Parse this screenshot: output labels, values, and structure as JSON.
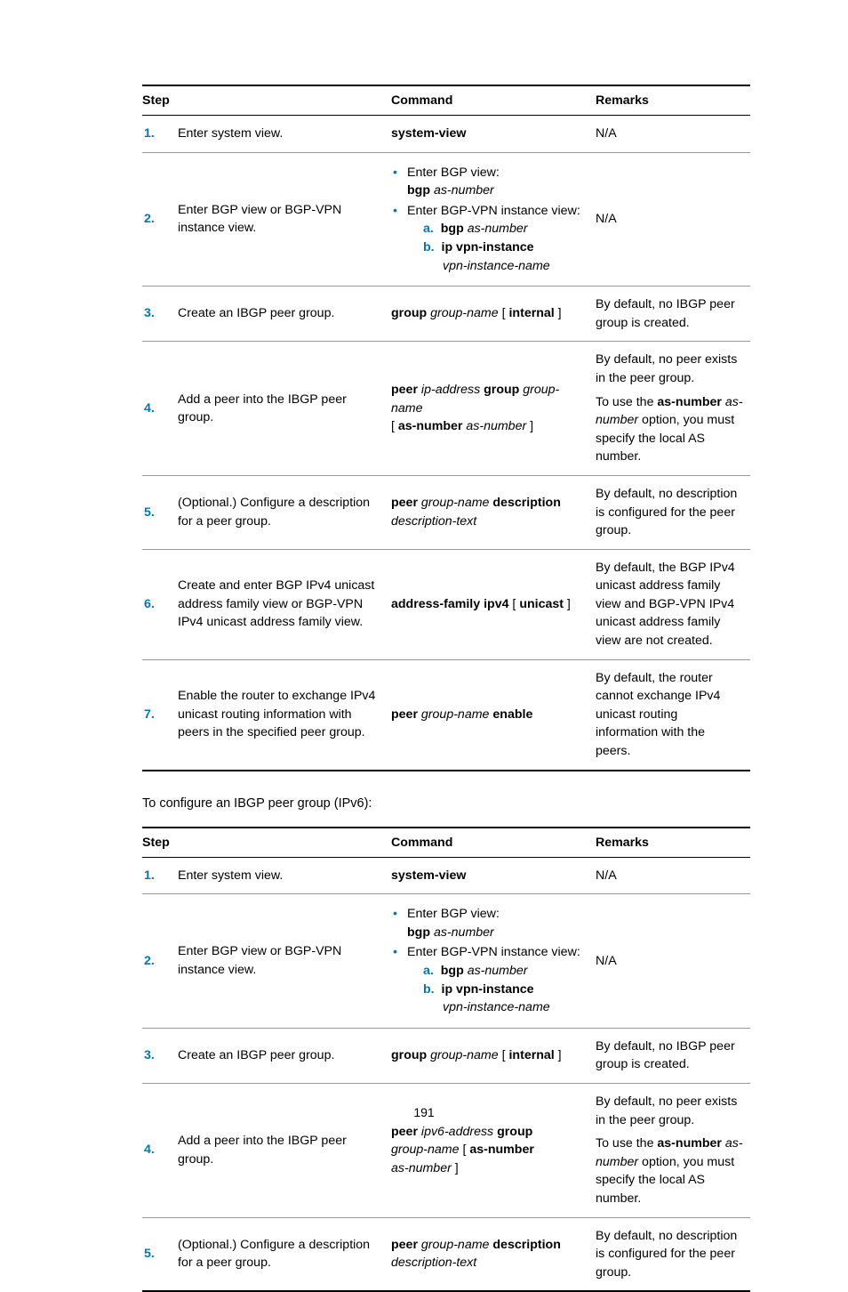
{
  "pageNumber": "191",
  "intro": "To configure an IBGP peer group (IPv6):",
  "headers": {
    "step": "Step",
    "command": "Command",
    "remarks": "Remarks"
  },
  "t1": {
    "r1": {
      "num": "1.",
      "step": "Enter system view.",
      "cmd_bold": "system-view",
      "rem": "N/A"
    },
    "r2": {
      "num": "2.",
      "step": "Enter BGP view or BGP-VPN instance view.",
      "b1": "Enter BGP view:",
      "b1_cmd_b": "bgp",
      "b1_cmd_i": "as-number",
      "b2": "Enter BGP-VPN instance view:",
      "a_lbl": "a.",
      "a_b": "bgp",
      "a_i": "as-number",
      "b_lbl": "b.",
      "b_b": "ip vpn-instance",
      "b_i": "vpn-instance-name",
      "rem": "N/A"
    },
    "r3": {
      "num": "3.",
      "step": "Create an IBGP peer group.",
      "c_b1": "group",
      "c_i1": "group-name",
      "c_t1": " [ ",
      "c_b2": "internal",
      "c_t2": " ]",
      "rem": "By default, no IBGP peer group is created."
    },
    "r4": {
      "num": "4.",
      "step": "Add a peer into the IBGP peer group.",
      "c_b1": "peer",
      "c_i1": "ip-address",
      "c_b2": "group",
      "c_i2": "group-name",
      "c_t1": "[ ",
      "c_b3": "as-number",
      "c_i3": "as-number",
      "c_t2": " ]",
      "rem1": "By default, no peer exists in the peer group.",
      "rem2a": "To use the ",
      "rem2b": "as-number",
      "rem2c": " ",
      "rem2d": "as-number",
      "rem2e": " option, you must specify the local AS number."
    },
    "r5": {
      "num": "5.",
      "step": "(Optional.) Configure a description for a peer group.",
      "c_b1": "peer",
      "c_i1": "group-name",
      "c_b2": "description",
      "c_i2": "description-text",
      "rem": "By default, no description is configured for the peer group."
    },
    "r6": {
      "num": "6.",
      "step": "Create and enter BGP IPv4 unicast address family view or BGP-VPN IPv4 unicast address family view.",
      "c_b1": "address-family ipv4",
      "c_t1": " [ ",
      "c_b2": "unicast",
      "c_t2": " ]",
      "rem": "By default, the BGP IPv4 unicast address family view and BGP-VPN IPv4 unicast address family view are not created."
    },
    "r7": {
      "num": "7.",
      "step": "Enable the router to exchange IPv4 unicast routing information with peers in the specified peer group.",
      "c_b1": "peer",
      "c_i1": "group-name",
      "c_b2": "enable",
      "rem": "By default, the router cannot exchange IPv4 unicast routing information with the peers."
    }
  },
  "t2": {
    "r1": {
      "num": "1.",
      "step": "Enter system view.",
      "cmd_bold": "system-view",
      "rem": "N/A"
    },
    "r2": {
      "num": "2.",
      "step": "Enter BGP view or BGP-VPN instance view.",
      "b1": "Enter BGP view:",
      "b1_cmd_b": "bgp",
      "b1_cmd_i": "as-number",
      "b2": "Enter BGP-VPN instance view:",
      "a_lbl": "a.",
      "a_b": "bgp",
      "a_i": "as-number",
      "b_lbl": "b.",
      "b_b": "ip vpn-instance",
      "b_i": "vpn-instance-name",
      "rem": "N/A"
    },
    "r3": {
      "num": "3.",
      "step": "Create an IBGP peer group.",
      "c_b1": "group",
      "c_i1": "group-name",
      "c_t1": " [ ",
      "c_b2": "internal",
      "c_t2": " ]",
      "rem": "By default, no IBGP peer group is created."
    },
    "r4": {
      "num": "4.",
      "step": "Add a peer into the IBGP peer group.",
      "c_b1": "peer",
      "c_i1": "ipv6-address",
      "c_b2": "group",
      "c_i2": "group-name",
      "c_t1": " [ ",
      "c_b3": "as-number",
      "c_i3": "as-number",
      "c_t2": " ]",
      "rem1": "By default, no peer exists in the peer group.",
      "rem2a": "To use the ",
      "rem2b": "as-number",
      "rem2c": " ",
      "rem2d": "as-number",
      "rem2e": " option, you must specify the local AS number."
    },
    "r5": {
      "num": "5.",
      "step": "(Optional.) Configure a description for a peer group.",
      "c_b1": "peer",
      "c_i1": "group-name",
      "c_b2": "description",
      "c_i2": "description-text",
      "rem": "By default, no description is configured for the peer group."
    }
  }
}
